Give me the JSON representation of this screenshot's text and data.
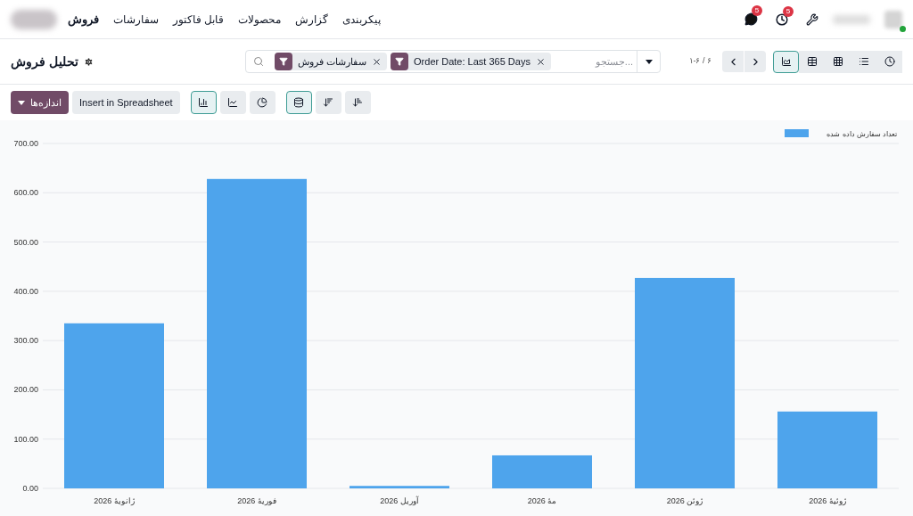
{
  "navbar": {
    "app": "فروش",
    "menu": [
      "پیکربندی",
      "گزارش",
      "محصولات",
      "قابل فاکتور",
      "سفارشات"
    ],
    "messages_badge": "5",
    "activities_badge": "5",
    "online": true
  },
  "control_panel": {
    "title": "تحلیل فروش",
    "facets": [
      {
        "label": "Order Date: Last 365 Days"
      },
      {
        "label": "سفارشات فروش"
      }
    ],
    "search": {
      "placeholder": "...جستجو"
    },
    "pager": "۱-۶ / ۶",
    "views": [
      {
        "kind": "graph",
        "selected": true
      },
      {
        "kind": "pivot",
        "selected": false
      },
      {
        "kind": "cohort",
        "selected": false
      },
      {
        "kind": "list",
        "selected": false
      },
      {
        "kind": "activity",
        "selected": false
      }
    ]
  },
  "toolbar": {
    "measures_button": "اندازه‌ها",
    "insert_button": "Insert in Spreadsheet",
    "chart_types": [
      {
        "kind": "bar",
        "selected": true
      },
      {
        "kind": "line",
        "selected": false
      },
      {
        "kind": "pie",
        "selected": false
      }
    ],
    "stacked": {
      "on": true
    },
    "sorts": [
      {
        "kind": "descending"
      },
      {
        "kind": "ascending"
      }
    ]
  },
  "chart_data": {
    "type": "bar",
    "grid": true,
    "categories": [
      "ژانویهٔ 2026",
      "فوریهٔ 2026",
      "آوریل 2026",
      "مهٔ 2026",
      "ژوئن 2026",
      "ژوئیهٔ 2026"
    ],
    "series": [
      {
        "name": "تعداد سفارش داده شده",
        "color": "#4ea4ec",
        "values": [
          335,
          628,
          5,
          67,
          427,
          156
        ]
      }
    ],
    "ylim": [
      0,
      700
    ],
    "yticks": [
      {
        "value": 0,
        "label": "0.00"
      },
      {
        "value": 100,
        "label": "100.00"
      },
      {
        "value": 200,
        "label": "200.00"
      },
      {
        "value": 300,
        "label": "300.00"
      },
      {
        "value": 400,
        "label": "400.00"
      },
      {
        "value": 500,
        "label": "500.00"
      },
      {
        "value": 600,
        "label": "600.00"
      },
      {
        "value": 700,
        "label": "700.00"
      }
    ]
  }
}
